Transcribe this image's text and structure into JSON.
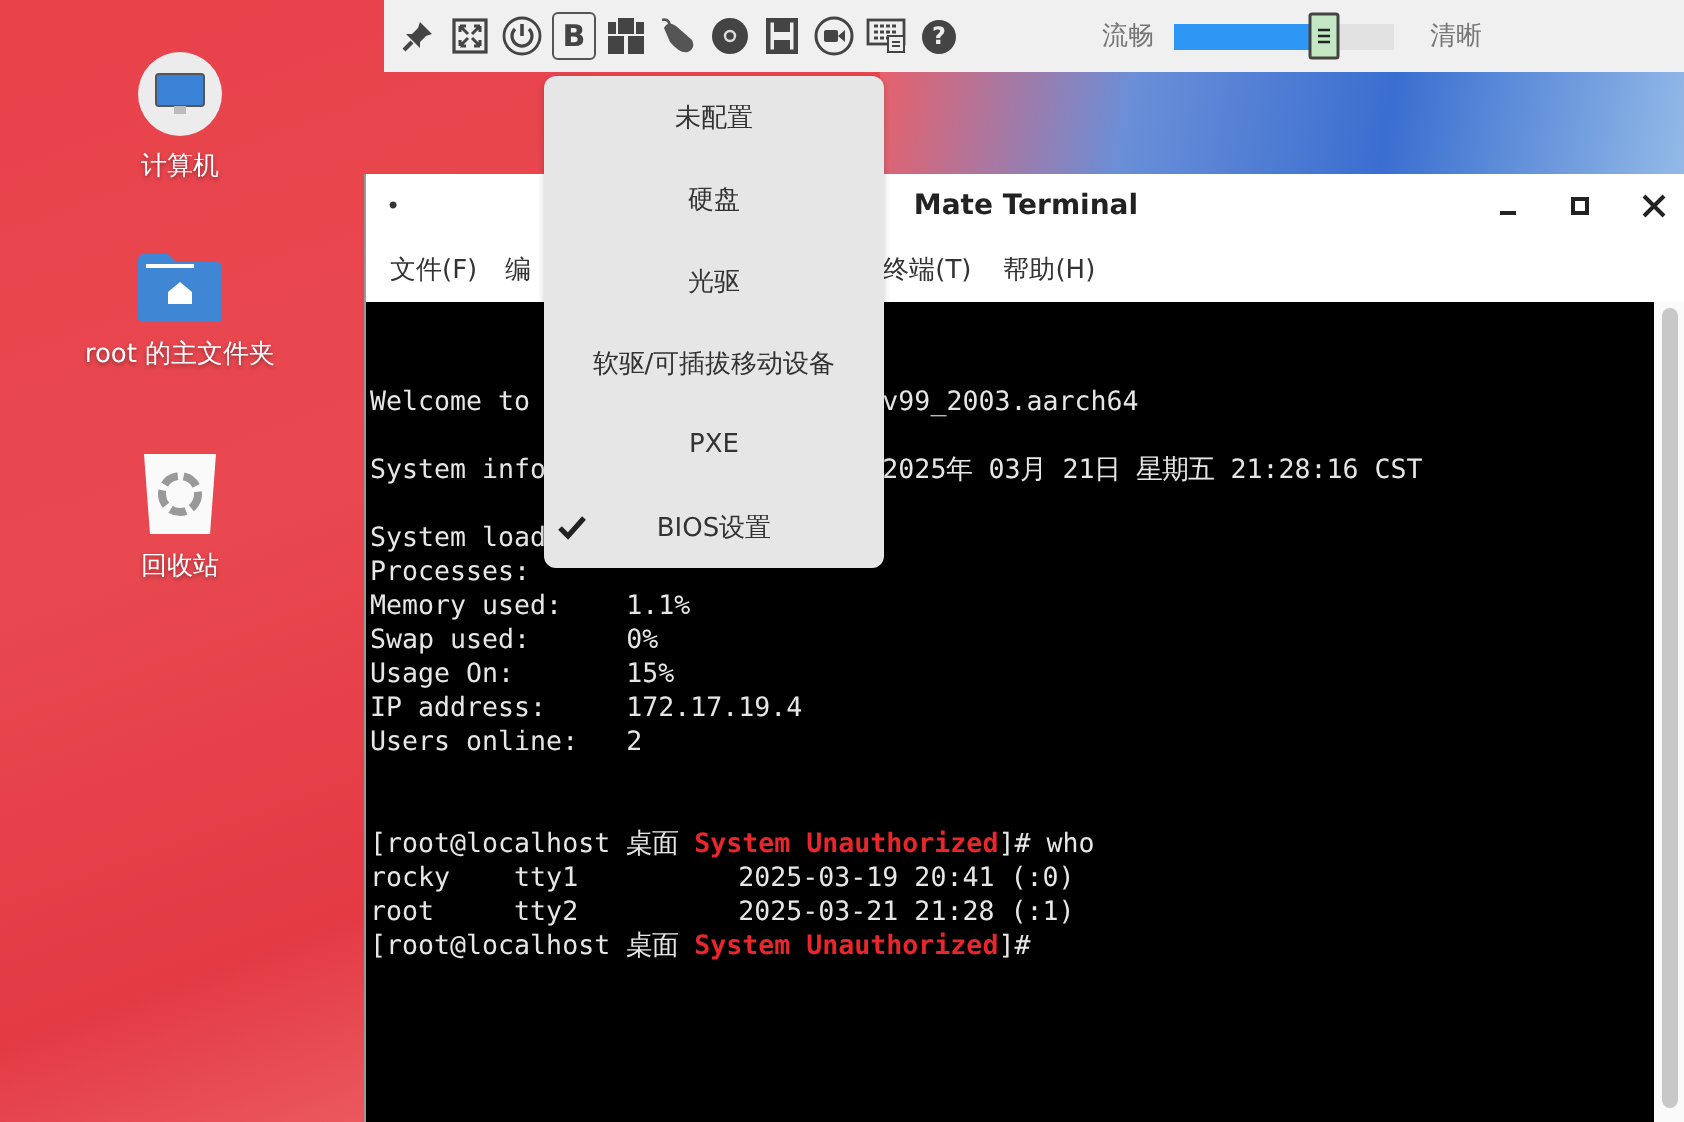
{
  "desktop_icons": [
    {
      "kind": "computer",
      "label": "计算机"
    },
    {
      "kind": "folder",
      "label": "root 的主文件夹"
    },
    {
      "kind": "trash",
      "label": "回收站"
    }
  ],
  "toolbar": {
    "buttons": [
      {
        "kind": "pin",
        "selected": false
      },
      {
        "kind": "fullscreen",
        "selected": false
      },
      {
        "kind": "power",
        "selected": false
      },
      {
        "kind": "letter",
        "label": "B",
        "selected": true
      },
      {
        "kind": "boot",
        "selected": false
      },
      {
        "kind": "mouse",
        "selected": false
      },
      {
        "kind": "disc",
        "selected": false
      },
      {
        "kind": "floppy",
        "selected": false
      },
      {
        "kind": "camera",
        "selected": false
      },
      {
        "kind": "keyboard",
        "selected": false
      },
      {
        "kind": "help",
        "label": "?",
        "selected": false
      }
    ],
    "quality": {
      "low_label": "流畅",
      "high_label": "清晰",
      "level": 0.67
    }
  },
  "boot_menu": {
    "items": [
      {
        "label": "未配置",
        "checked": false
      },
      {
        "label": "硬盘",
        "checked": false
      },
      {
        "label": "光驱",
        "checked": false
      },
      {
        "label": "软驱/可插拔移动设备",
        "checked": false
      },
      {
        "label": "PXE",
        "checked": false
      },
      {
        "label": "BIOS设置",
        "checked": true
      }
    ]
  },
  "terminal": {
    "title_dot": "•",
    "title": "Mate Terminal",
    "menu": [
      "文件(F)",
      "编",
      "终端(T)",
      "帮助(H)"
    ],
    "lines": [
      {
        "kind": "blank"
      },
      {
        "kind": "blank"
      },
      {
        "kind": "text",
        "left": "Welcome to",
        "right": "v99_2003.aarch64"
      },
      {
        "kind": "blank"
      },
      {
        "kind": "text",
        "left": "System info",
        "right": "2025年 03月 21日 星期五 21:28:16 CST"
      },
      {
        "kind": "blank"
      },
      {
        "kind": "text",
        "left": "System load"
      },
      {
        "kind": "text",
        "left": "Processes:"
      },
      {
        "kind": "text",
        "left": "Memory used:    1.1%"
      },
      {
        "kind": "text",
        "left": "Swap used:      0%"
      },
      {
        "kind": "text",
        "left": "Usage On:       15%"
      },
      {
        "kind": "text",
        "left": "IP address:     172.17.19.4"
      },
      {
        "kind": "text",
        "left": "Users online:   2"
      },
      {
        "kind": "blank"
      },
      {
        "kind": "blank"
      },
      {
        "kind": "prompt",
        "user": "[root@localhost 桌面",
        "status": "System Unauthorized",
        "end": "]#",
        "command": "who"
      },
      {
        "kind": "text",
        "left": "rocky    tty1          2025-03-19 20:41 (:0)"
      },
      {
        "kind": "text",
        "left": "root     tty2          2025-03-21 21:28 (:1)"
      },
      {
        "kind": "prompt",
        "user": "[root@localhost 桌面",
        "status": "System Unauthorized",
        "end": "]#"
      }
    ]
  }
}
